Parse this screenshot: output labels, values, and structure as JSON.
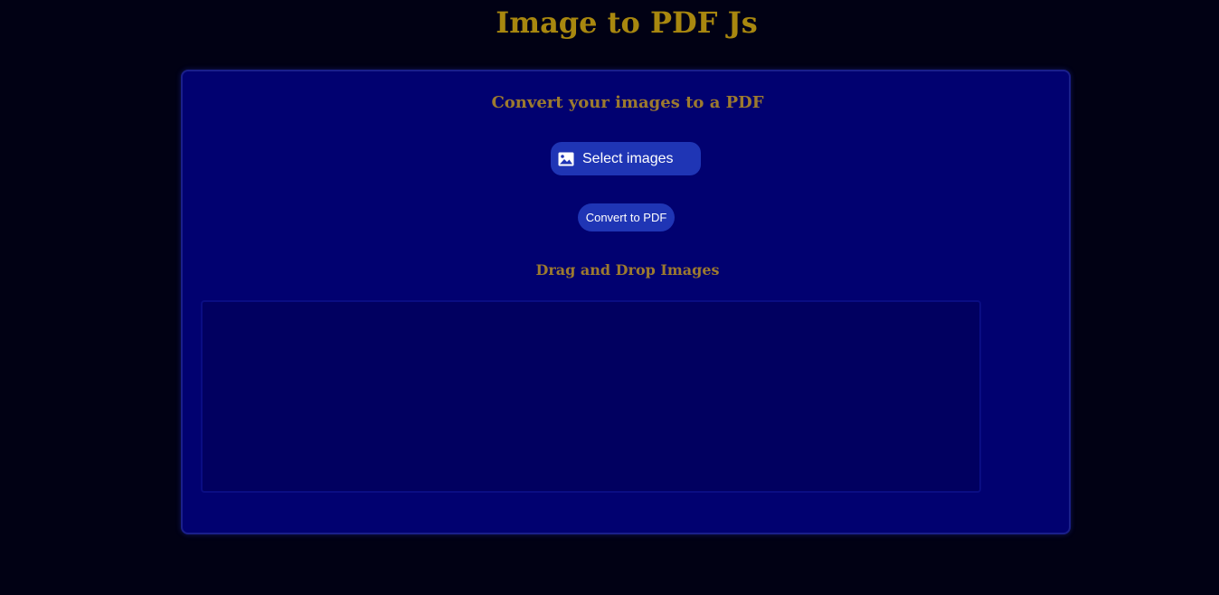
{
  "app": {
    "title": "Image to PDF Js"
  },
  "card": {
    "subtitle": "Convert your images to a PDF",
    "select_button": {
      "icon": "image-icon",
      "label": "Select images"
    },
    "convert_button": {
      "label": "Convert to PDF"
    },
    "drag_title": "Drag and Drop Images"
  },
  "colors": {
    "page_background": "#010114",
    "card_background": "#010170",
    "title_color": "#a8870f",
    "heading_color": "#9c7a2f",
    "button_background": "#1f35b5",
    "drop_zone_background": "#010060"
  }
}
